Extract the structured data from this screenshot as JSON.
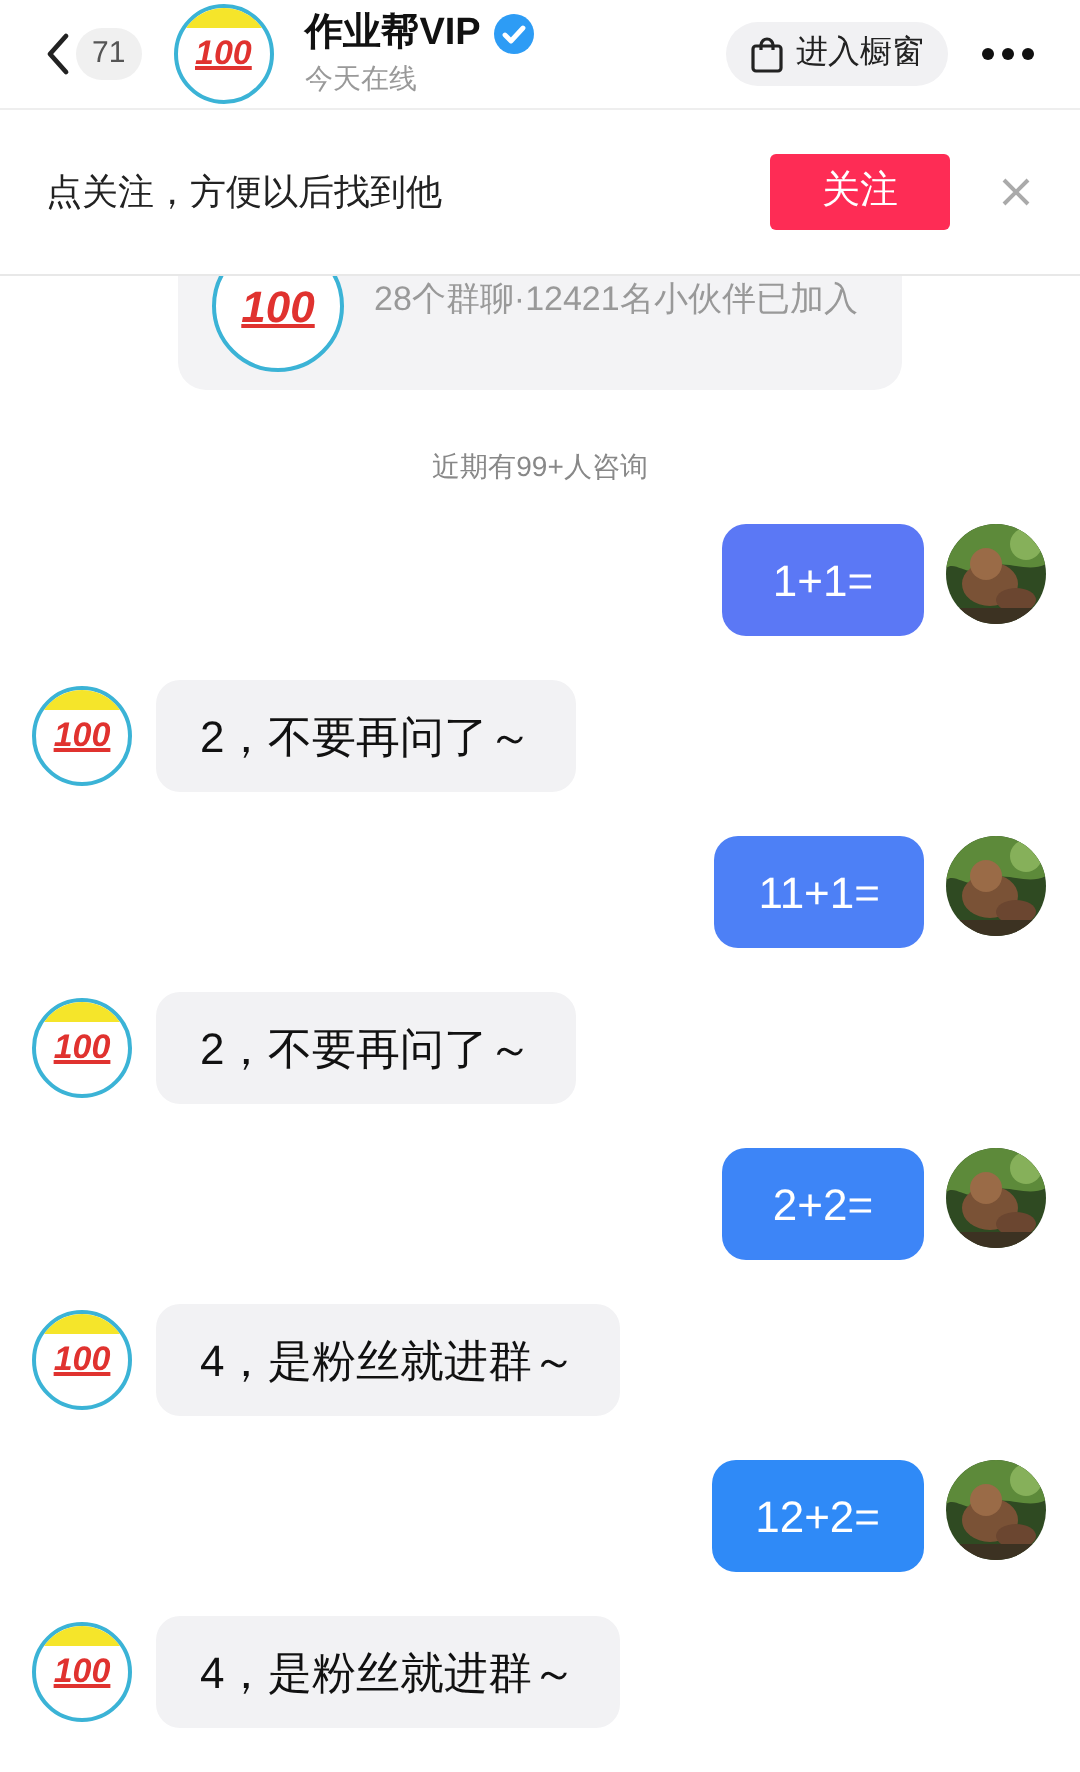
{
  "header": {
    "back_count": "71",
    "avatar_text": "100",
    "name": "作业帮VIP",
    "verified": true,
    "status": "今天在线",
    "shop_button": "进入橱窗"
  },
  "follow_banner": {
    "text": "点关注，方便以后找到他",
    "button": "关注"
  },
  "group_card": {
    "avatar_text": "100",
    "text": "28个群聊·12421名小伙伴已加入"
  },
  "notice": "近期有99+人咨询",
  "messages": [
    {
      "kind": "sent",
      "text": "1+1=",
      "color": "#5b78f5"
    },
    {
      "kind": "received",
      "avatar_text": "100",
      "text": "2，不要再问了～"
    },
    {
      "kind": "sent",
      "text": "11+1=",
      "color": "#4d80f6"
    },
    {
      "kind": "received",
      "avatar_text": "100",
      "text": "2，不要再问了～"
    },
    {
      "kind": "sent",
      "text": "2+2=",
      "color": "#3d85f7"
    },
    {
      "kind": "received",
      "avatar_text": "100",
      "text": "4，是粉丝就进群～"
    },
    {
      "kind": "sent",
      "text": "12+2=",
      "color": "#2f8af7"
    },
    {
      "kind": "received",
      "avatar_text": "100",
      "text": "4，是粉丝就进群～"
    }
  ]
}
